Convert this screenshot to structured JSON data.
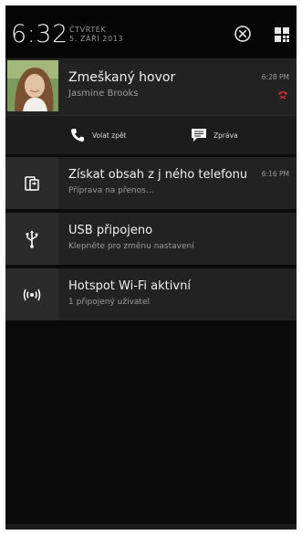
{
  "status_bar": {
    "clock": "6:32",
    "weekday": "ČTVRTEK",
    "date": "5. ZÁŘÍ 2013",
    "clear_icon": "close-circle-icon",
    "settings_icon": "quick-settings-icon"
  },
  "notifications": [
    {
      "title": "Zmeškaný hovor",
      "subtitle": "Jasmine Brooks",
      "time": "6:28 PM",
      "icon": "missed-call-icon",
      "actions": [
        {
          "label": "Volat zpět",
          "icon": "phone-icon"
        },
        {
          "label": "Zpráva",
          "icon": "message-icon"
        }
      ]
    },
    {
      "title": "Získat obsah z j ného telefonu",
      "subtitle": "Příprava na přenos...",
      "time": "6:16 PM",
      "icon": "transfer-icon"
    },
    {
      "title": "USB připojeno",
      "subtitle": "Klepněte pro změnu nastavení",
      "icon": "usb-icon"
    },
    {
      "title": "Hotspot Wi-Fi aktivní",
      "subtitle": "1 připojený uživatel",
      "icon": "wifi-hotspot-icon"
    }
  ],
  "colors": {
    "background": "#0b0b0b",
    "card": "#222222",
    "icon_column": "#2b2b2b",
    "missed_call_red": "#d0312d"
  }
}
